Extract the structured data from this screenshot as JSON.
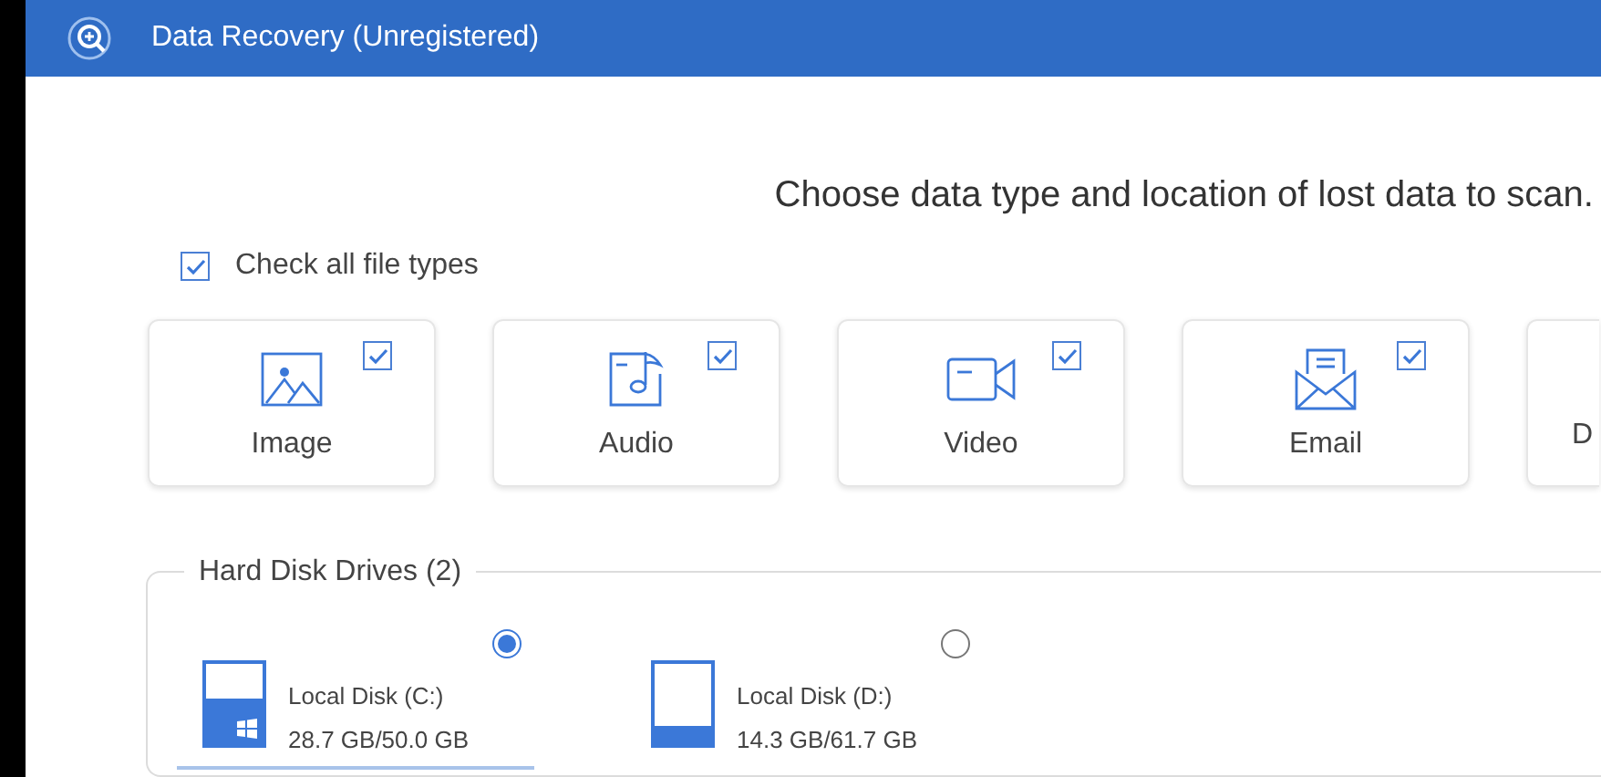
{
  "window": {
    "title": "Data Recovery (Unregistered)"
  },
  "heading": "Choose data type and location of lost data to scan.",
  "check_all": {
    "label": "Check all file types",
    "checked": true
  },
  "file_types": [
    {
      "kind": "image",
      "label": "Image",
      "checked": true
    },
    {
      "kind": "audio",
      "label": "Audio",
      "checked": true
    },
    {
      "kind": "video",
      "label": "Video",
      "checked": true
    },
    {
      "kind": "email",
      "label": "Email",
      "checked": true
    },
    {
      "kind": "partial",
      "label": "D"
    }
  ],
  "hard_disk_drives": {
    "title": "Hard Disk Drives (2)",
    "drives": [
      {
        "name": "Local Disk (C:)",
        "size": "28.7 GB/50.0 GB",
        "level": 0.57,
        "system": true,
        "selected": true
      },
      {
        "name": "Local Disk (D:)",
        "size": "14.3 GB/61.7 GB",
        "level": 0.23,
        "system": false,
        "selected": false
      }
    ]
  }
}
